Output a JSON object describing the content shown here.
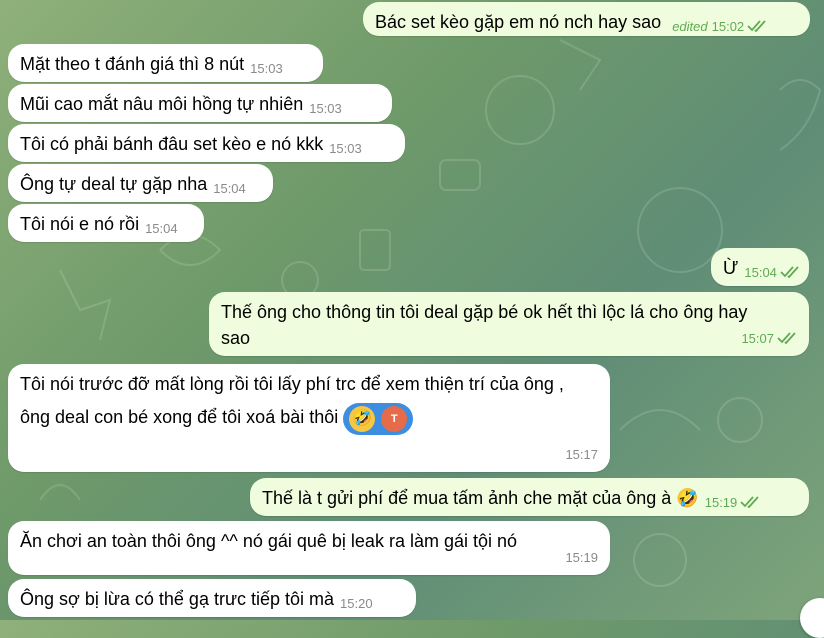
{
  "messages": [
    {
      "text": "Bác set kèo gặp em nó nch hay sao",
      "edited": "edited",
      "time": "15:02"
    },
    {
      "text": "Mặt theo t đánh giá thì 8 nút",
      "time": "15:03"
    },
    {
      "text": "Mũi cao mắt nâu môi hồng tự nhiên",
      "time": "15:03"
    },
    {
      "text": "Tôi có phải bánh đâu set kèo e nó kkk",
      "time": "15:03"
    },
    {
      "text": "Ông tự deal tự gặp nha",
      "time": "15:04"
    },
    {
      "text": "Tôi nói e nó rồi",
      "time": "15:04"
    },
    {
      "text": "Ừ",
      "time": "15:04"
    },
    {
      "text": "Thế ông cho thông tin tôi deal gặp bé ok hết thì lộc lá cho ông hay sao",
      "time": "15:07"
    },
    {
      "text": "Tôi nói trước đỡ mất lòng rồi tôi lấy phí trc để xem thiện trí của ông , ông deal con bé xong để tôi xoá bài thôi",
      "time": "15:17",
      "reaction_emoji": "🤣",
      "reaction_avatar": "T"
    },
    {
      "text": "Thế là t gửi phí để mua tấm ảnh che mặt của ông à",
      "emoji": "🤣",
      "time": "15:19"
    },
    {
      "text": "Ăn chơi an toàn thôi ông ^^ nó gái quê bị leak ra làm gái tội nó",
      "time": "15:19"
    },
    {
      "text": "Ông sợ bị lừa có thể gạ trưc tiếp tôi mà",
      "time": "15:20"
    }
  ]
}
